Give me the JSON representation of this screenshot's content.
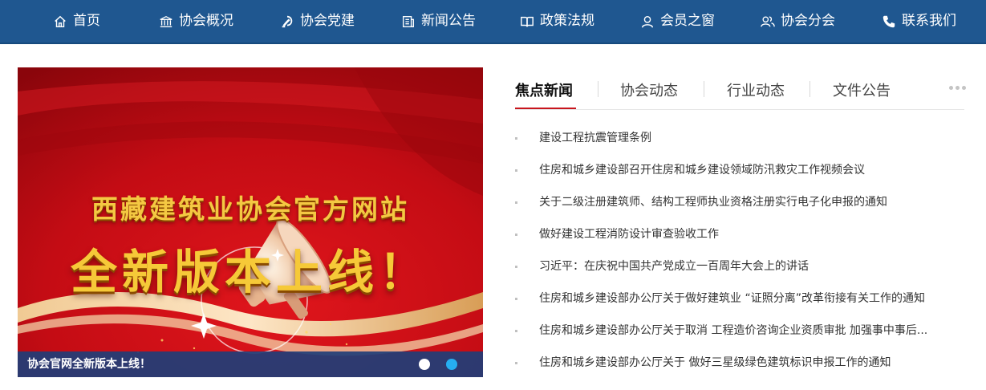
{
  "nav": {
    "items": [
      {
        "label": "首页",
        "icon": "home-icon"
      },
      {
        "label": "协会概况",
        "icon": "institution-icon"
      },
      {
        "label": "协会党建",
        "icon": "party-emblem-icon"
      },
      {
        "label": "新闻公告",
        "icon": "news-icon"
      },
      {
        "label": "政策法规",
        "icon": "book-icon"
      },
      {
        "label": "会员之窗",
        "icon": "user-icon"
      },
      {
        "label": "协会分会",
        "icon": "users-icon"
      },
      {
        "label": "联系我们",
        "icon": "phone-icon"
      }
    ]
  },
  "banner": {
    "headline": "西藏建筑业协会官方网站",
    "subheadline": "全新版本上线！",
    "caption": "协会官网全新版本上线！",
    "slide_count": 2,
    "active_slide": 2
  },
  "tabs": {
    "items": [
      {
        "label": "焦点新闻",
        "active": true
      },
      {
        "label": "协会动态",
        "active": false
      },
      {
        "label": "行业动态",
        "active": false
      },
      {
        "label": "文件公告",
        "active": false
      }
    ],
    "more_icon": "more-dots-icon"
  },
  "news": [
    {
      "title": "建设工程抗震管理条例"
    },
    {
      "title": "住房和城乡建设部召开住房和城乡建设领域防汛救灾工作视频会议"
    },
    {
      "title": "关于二级注册建筑师、结构工程师执业资格注册实行电子化申报的通知"
    },
    {
      "title": "做好建设工程消防设计审查验收工作"
    },
    {
      "title": "习近平：在庆祝中国共产党成立一百周年大会上的讲话"
    },
    {
      "title": "住房和城乡建设部办公厅关于做好建筑业 “证照分离”改革衔接有关工作的通知"
    },
    {
      "title": "住房和城乡建设部办公厅关于取消 工程造价咨询企业资质审批 加强事中事后..."
    },
    {
      "title": "住房和城乡建设部办公厅关于 做好三星级绿色建筑标识申报工作的通知"
    }
  ],
  "colors": {
    "nav_bg": "#1f5790",
    "banner_red": "#b30a12",
    "gold": "#f4c842",
    "tab_accent": "#c8161d",
    "caption_bg": "#1f3e78",
    "dot_active": "#26aef0"
  }
}
